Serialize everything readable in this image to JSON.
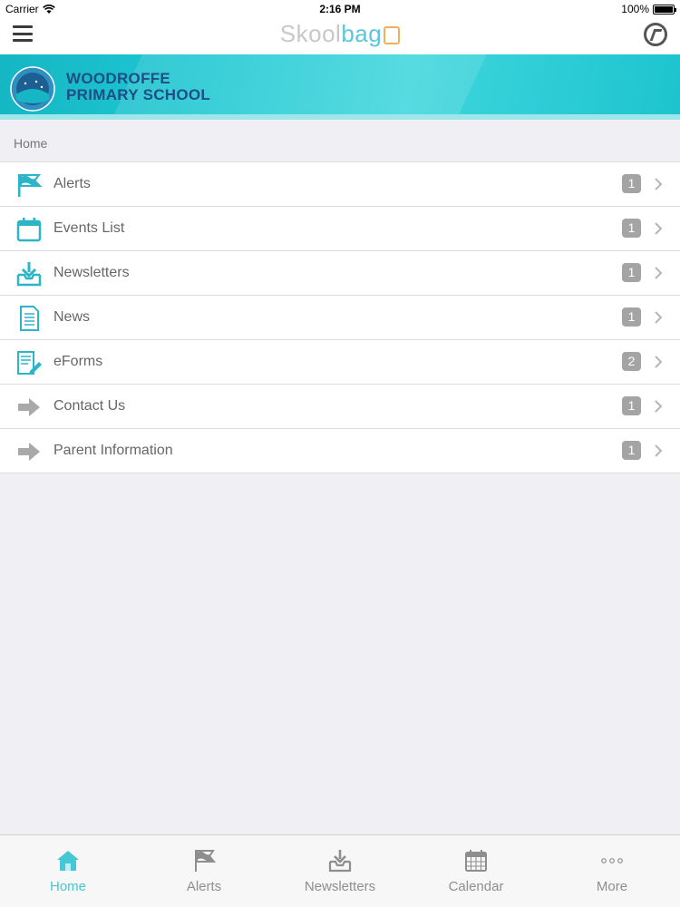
{
  "status_bar": {
    "carrier": "Carrier",
    "time": "2:16 PM",
    "battery": "100%"
  },
  "nav": {
    "brand_left": "Skool",
    "brand_right": "bag"
  },
  "banner": {
    "school_line1": "WOODROFFE",
    "school_line2": "PRIMARY SCHOOL",
    "logo_text": "WOODROFFE PRIMARY"
  },
  "breadcrumb": "Home",
  "menu": [
    {
      "label": "Alerts",
      "count": "1",
      "icon": "flag-icon"
    },
    {
      "label": "Events List",
      "count": "1",
      "icon": "calendar-icon"
    },
    {
      "label": "Newsletters",
      "count": "1",
      "icon": "inbox-download-icon"
    },
    {
      "label": "News",
      "count": "1",
      "icon": "document-icon"
    },
    {
      "label": "eForms",
      "count": "2",
      "icon": "form-pencil-icon"
    },
    {
      "label": "Contact Us",
      "count": "1",
      "icon": "arrow-right-icon"
    },
    {
      "label": "Parent Information",
      "count": "1",
      "icon": "arrow-right-icon"
    }
  ],
  "tabs": [
    {
      "label": "Home",
      "icon": "home-icon",
      "active": true
    },
    {
      "label": "Alerts",
      "icon": "flag-icon",
      "active": false
    },
    {
      "label": "Newsletters",
      "icon": "inbox-download-icon",
      "active": false
    },
    {
      "label": "Calendar",
      "icon": "calendar-icon",
      "active": false
    },
    {
      "label": "More",
      "icon": "more-dots-icon",
      "active": false
    }
  ],
  "colors": {
    "accent": "#45c8d6",
    "icon_teal": "#2ab6c8",
    "badge": "#a4a4a4",
    "banner": "#1ec8d3",
    "school_name": "#1f4d86"
  }
}
